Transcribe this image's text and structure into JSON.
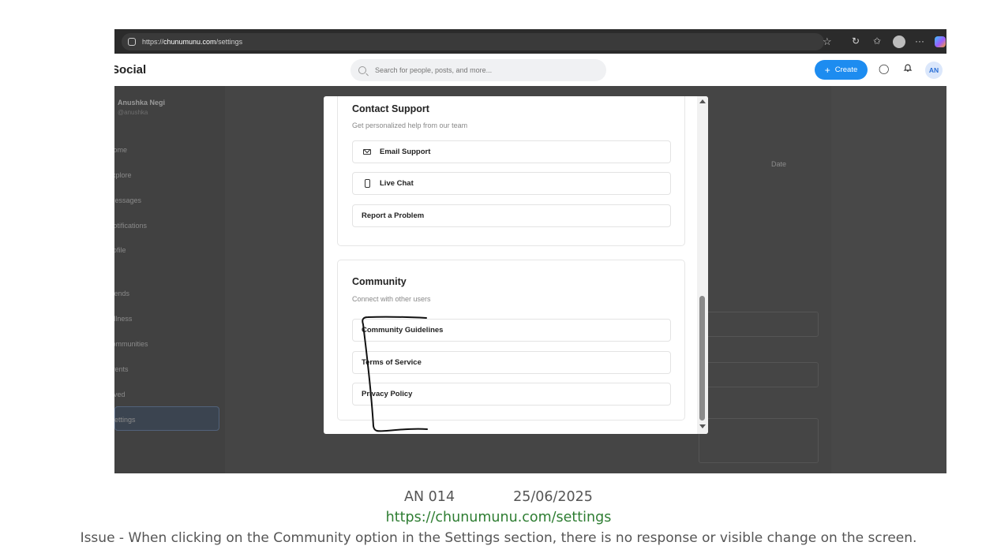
{
  "browser": {
    "url_prefix": "https://",
    "url_host": "chunumunu.com",
    "url_path": "/settings",
    "icons": [
      "site-info-icon",
      "favorite-star-icon",
      "refresh-icon",
      "favorites-icon",
      "profile-avatar-icon",
      "more-icon",
      "copilot-icon"
    ],
    "more_label": "···"
  },
  "header": {
    "brand": "Social",
    "search_placeholder": "Search for people, posts, and more...",
    "create_label": "Create",
    "avatar_initials": "AN",
    "accent": "#1d8cf0"
  },
  "sidebar": {
    "user_name": "Anushka Negi",
    "user_handle": "@anushka",
    "items": [
      {
        "label": "Home"
      },
      {
        "label": "Explore"
      },
      {
        "label": "Messages"
      },
      {
        "label": "Notifications"
      },
      {
        "label": "Profile"
      },
      {
        "label": "Friends"
      },
      {
        "label": "Wellness"
      },
      {
        "label": "Communities"
      },
      {
        "label": "Events"
      },
      {
        "label": "Saved"
      },
      {
        "label": "Settings"
      }
    ],
    "active_item": "Settings"
  },
  "background": {
    "date_label": "Date"
  },
  "modal": {
    "contact_support": {
      "title": "Contact Support",
      "subtitle": "Get personalized help from our team",
      "options": [
        {
          "label": "Email Support",
          "icon": "mail-icon"
        },
        {
          "label": "Live Chat",
          "icon": "phone-icon"
        },
        {
          "label": "Report a Problem"
        }
      ]
    },
    "community": {
      "title": "Community",
      "subtitle": "Connect with other users",
      "options": [
        {
          "label": "Community Guidelines"
        },
        {
          "label": "Terms of Service"
        },
        {
          "label": "Privacy Policy"
        }
      ]
    }
  },
  "caption": {
    "id": "AN 014",
    "date": "25/06/2025",
    "url": "https://chunumunu.com/settings",
    "issue": "Issue -  When clicking on the Community option in the Settings section, there is no response or visible change on the screen."
  },
  "colors": {
    "caption_url": "#2e7d32",
    "annotation": "#111111"
  }
}
